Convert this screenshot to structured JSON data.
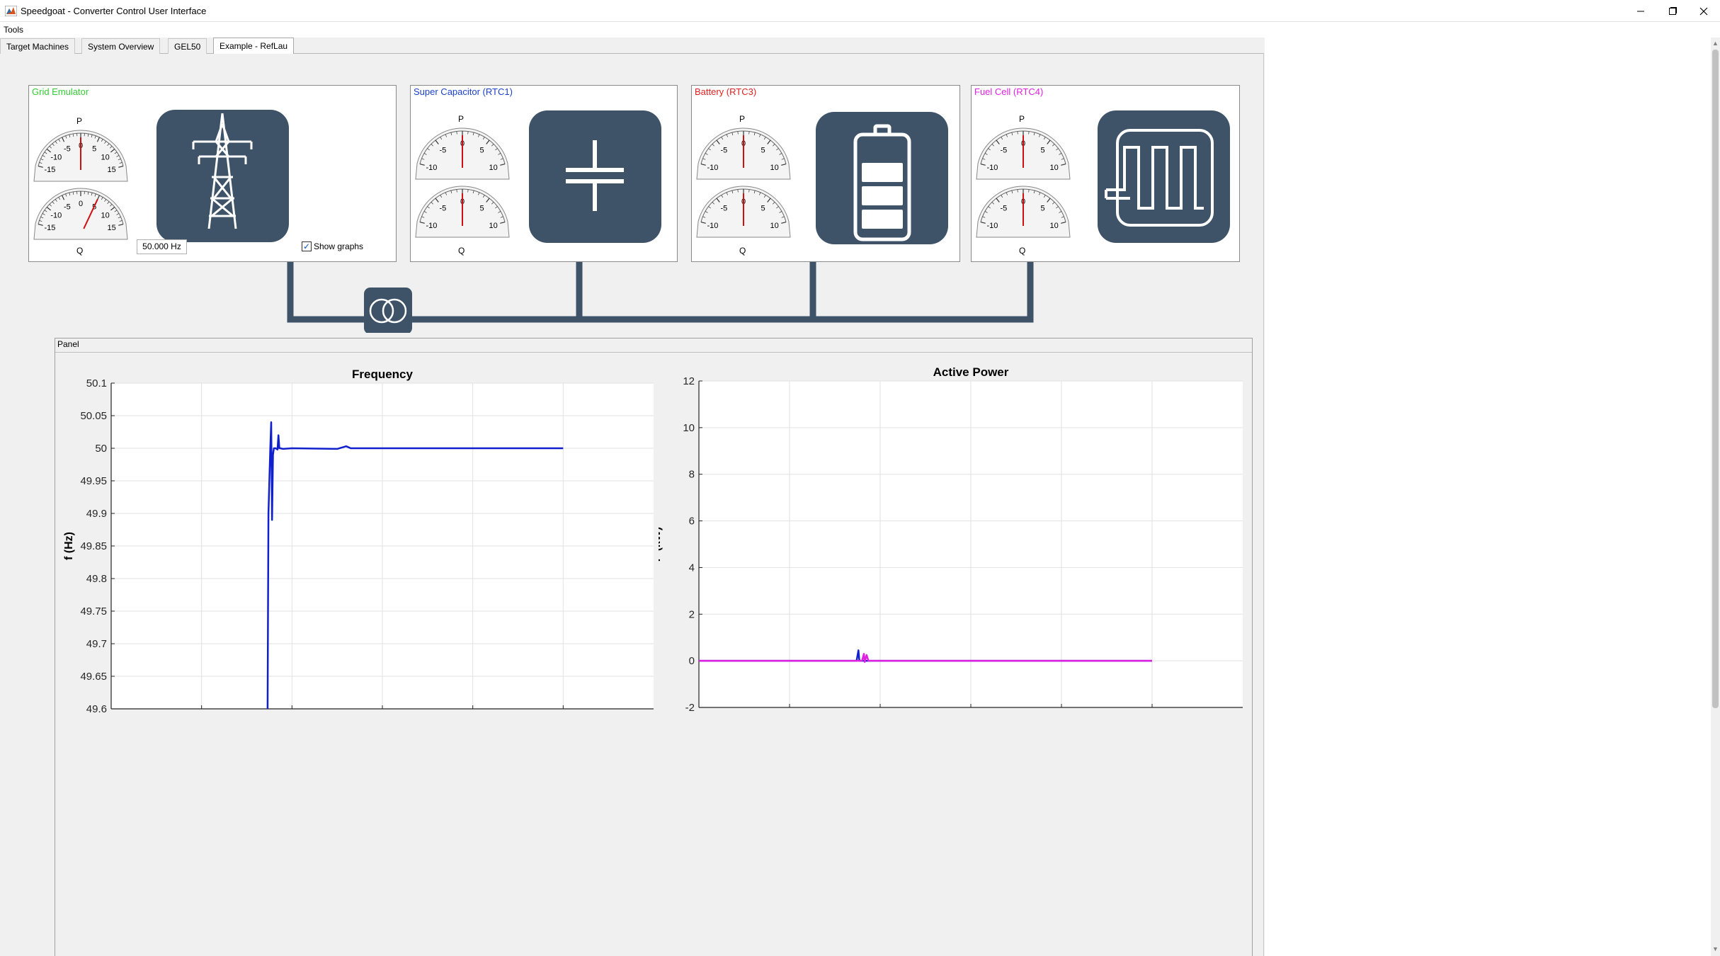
{
  "window": {
    "title": "Speedgoat - Converter Control User Interface",
    "controls": [
      "minimize-icon",
      "maximize-icon",
      "close-icon"
    ]
  },
  "menu": {
    "tools": "Tools"
  },
  "tabs": [
    {
      "label": "Target Machines",
      "active": false
    },
    {
      "label": "System Overview",
      "active": false
    },
    {
      "label": "GEL50",
      "active": false
    },
    {
      "label": "Example - RefLau",
      "active": true
    }
  ],
  "devices": {
    "grid": {
      "title": "Grid Emulator",
      "color": "#33cc33",
      "icon": "power-tower-icon",
      "p_label": "P",
      "q_label": "Q",
      "p_gauge": {
        "ticks": [
          "-15",
          "-10",
          "-5",
          "0",
          "5",
          "10",
          "15"
        ],
        "value": 0
      },
      "q_gauge": {
        "ticks": [
          "-15",
          "-10",
          "-5",
          "0",
          "5",
          "10",
          "15"
        ],
        "value": 5
      },
      "frequency": "50.000 Hz",
      "show_graphs_label": "Show graphs",
      "show_graphs_checked": true
    },
    "supercap": {
      "title": "Super Capacitor (RTC1)",
      "color": "#1a3fcc",
      "icon": "capacitor-icon",
      "p_label": "P",
      "q_label": "Q",
      "p_gauge": {
        "ticks": [
          "-10",
          "-5",
          "0",
          "5",
          "10"
        ],
        "value": 0
      },
      "q_gauge": {
        "ticks": [
          "-10",
          "-5",
          "0",
          "5",
          "10"
        ],
        "value": 0
      }
    },
    "battery": {
      "title": "Battery (RTC3)",
      "color": "#e02020",
      "icon": "battery-icon",
      "p_label": "P",
      "q_label": "Q",
      "p_gauge": {
        "ticks": [
          "-10",
          "-5",
          "0",
          "5",
          "10"
        ],
        "value": 0
      },
      "q_gauge": {
        "ticks": [
          "-10",
          "-5",
          "0",
          "5",
          "10"
        ],
        "value": 0
      }
    },
    "fuelcell": {
      "title": "Fuel Cell (RTC4)",
      "color": "#e020e0",
      "icon": "fuel-cell-icon",
      "p_label": "P",
      "q_label": "Q",
      "p_gauge": {
        "ticks": [
          "-10",
          "-5",
          "0",
          "5",
          "10"
        ],
        "value": 0
      },
      "q_gauge": {
        "ticks": [
          "-10",
          "-5",
          "0",
          "5",
          "10"
        ],
        "value": 0
      }
    }
  },
  "bus": {
    "transformer_icon": "transformer-icon",
    "color": "#3e5367"
  },
  "graph_panel": {
    "title": "Panel"
  },
  "chart_data": [
    {
      "type": "line",
      "title": "Frequency",
      "xlabel": "",
      "ylabel": "f (Hz)",
      "ylim": [
        49.6,
        50.1
      ],
      "yticks": [
        "50.1",
        "50.05",
        "50",
        "49.95",
        "49.9",
        "49.85",
        "49.8",
        "49.75",
        "49.7",
        "49.65",
        "49.6"
      ],
      "xlim": [
        0,
        6
      ],
      "grid": true,
      "series": [
        {
          "color": "#1020cc",
          "x": [
            1.73,
            1.74,
            1.76,
            1.77,
            1.78,
            1.79,
            1.8,
            1.82,
            1.84,
            1.85,
            1.86,
            1.87,
            1.9,
            2.0,
            2.5,
            2.6,
            2.65,
            3.0,
            4.0,
            5.0
          ],
          "y": [
            49.6,
            49.9,
            50.0,
            50.04,
            49.89,
            49.99,
            50.0,
            50.0,
            49.998,
            50.02,
            50.0,
            50.0,
            49.999,
            50.0,
            49.999,
            50.003,
            50.0,
            50.0,
            50.0,
            50.0
          ]
        }
      ]
    },
    {
      "type": "line",
      "title": "Active Power",
      "xlabel": "",
      "ylabel": "P (kW)",
      "ylim": [
        -2,
        12
      ],
      "yticks": [
        "12",
        "10",
        "8",
        "6",
        "4",
        "2",
        "0",
        "-2"
      ],
      "xlim": [
        0,
        6
      ],
      "grid": true,
      "series": [
        {
          "color": "#1020cc",
          "x": [
            0,
            1.74,
            1.76,
            1.77,
            1.78,
            1.8,
            5.0
          ],
          "y": [
            0,
            0,
            0.45,
            0,
            0,
            0,
            0
          ]
        },
        {
          "color": "#e020e0",
          "x": [
            0,
            1.8,
            1.82,
            1.83,
            1.85,
            1.87,
            5.0
          ],
          "y": [
            0,
            0,
            0.3,
            -0.05,
            0.25,
            0,
            0
          ]
        }
      ]
    }
  ]
}
